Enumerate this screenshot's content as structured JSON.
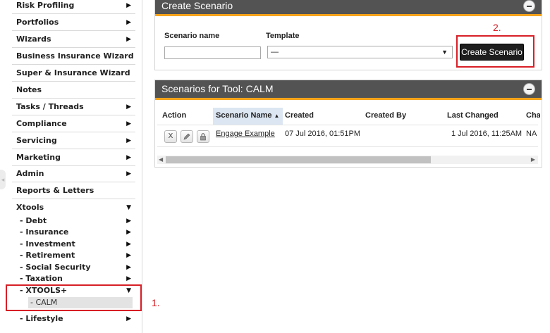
{
  "sidebar": {
    "items": [
      {
        "label": "Risk Profiling",
        "has_arrow": true
      },
      {
        "label": "Portfolios",
        "has_arrow": true
      },
      {
        "label": "Wizards",
        "has_arrow": true
      },
      {
        "label": "Business Insurance Wizard",
        "has_arrow": false
      },
      {
        "label": "Super & Insurance Wizard",
        "has_arrow": false
      },
      {
        "label": "Notes",
        "has_arrow": false
      },
      {
        "label": "Tasks / Threads",
        "has_arrow": true
      },
      {
        "label": "Compliance",
        "has_arrow": true
      },
      {
        "label": "Servicing",
        "has_arrow": true
      },
      {
        "label": "Marketing",
        "has_arrow": true
      },
      {
        "label": "Admin",
        "has_arrow": true
      },
      {
        "label": "Reports & Letters",
        "has_arrow": false
      },
      {
        "label": "Xtools",
        "expanded": true
      }
    ],
    "xtools_children": [
      "- Debt",
      "- Insurance",
      "- Investment",
      "- Retirement",
      "- Social Security",
      "- Taxation",
      "- XTOOLS+"
    ],
    "xtools_plus_child": "- CALM",
    "lifestyle": "- Lifestyle"
  },
  "annotations": {
    "step1": "1.",
    "step2": "2."
  },
  "create_panel": {
    "title": "Create Scenario",
    "scenario_name_label": "Scenario name",
    "scenario_name_value": "",
    "template_label": "Template",
    "template_value": "—",
    "button_label": "Create Scenario"
  },
  "list_panel": {
    "title": "Scenarios for Tool: CALM",
    "columns": [
      "Action",
      "Scenario Name",
      "Created",
      "Created By",
      "Last Changed",
      "Cha"
    ],
    "sorted_column": "Scenario Name",
    "rows": [
      {
        "actions": [
          "X",
          "edit-icon",
          "lock-icon"
        ],
        "name": "Engage Example",
        "created": "07 Jul 2016, 01:51PM",
        "created_by": "",
        "last_changed": "1 Jul 2016, 11:25AM",
        "changed_by": "NA"
      }
    ]
  },
  "colors": {
    "header_bg": "#535353",
    "accent": "#f6a31a",
    "highlight_red": "#d81f26",
    "button_bg": "#1e1e1e"
  }
}
